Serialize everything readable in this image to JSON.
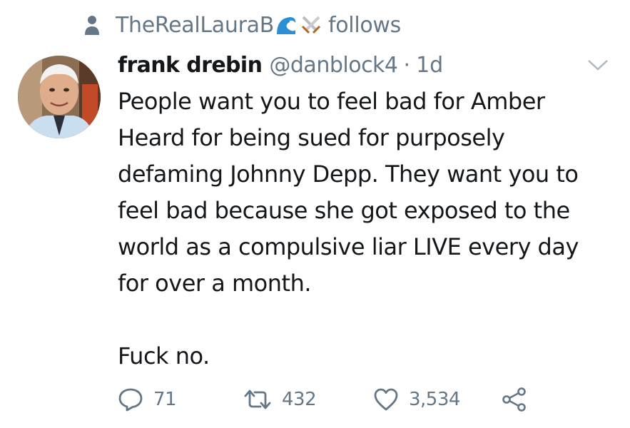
{
  "context": {
    "text": "TheRealLauraB",
    "emojis": [
      "wave-emoji",
      "crossed-swords-emoji"
    ],
    "suffix": "follows"
  },
  "tweet": {
    "display_name": "frank drebin",
    "handle": "@danblock4",
    "separator": "·",
    "time": "1d",
    "body_lines": [
      "People want you to feel bad for Amber",
      "Heard for being sued for purposely",
      "defaming Johnny Depp. They want you to",
      "feel bad because she got exposed to the",
      "world as a compulsive liar LIVE every day",
      "for over a month."
    ],
    "body_last": "Fuck no."
  },
  "actions": {
    "reply_count": "71",
    "retweet_count": "432",
    "like_count": "3,534"
  },
  "icons": {
    "person": "person-icon",
    "chevron": "chevron-down-icon",
    "reply": "reply-icon",
    "retweet": "retweet-icon",
    "like": "heart-icon",
    "share": "share-icon"
  },
  "colors": {
    "text": "#14171a",
    "secondary": "#657786",
    "wave": "#2b8fd6",
    "swords": "#b9bcc0"
  }
}
